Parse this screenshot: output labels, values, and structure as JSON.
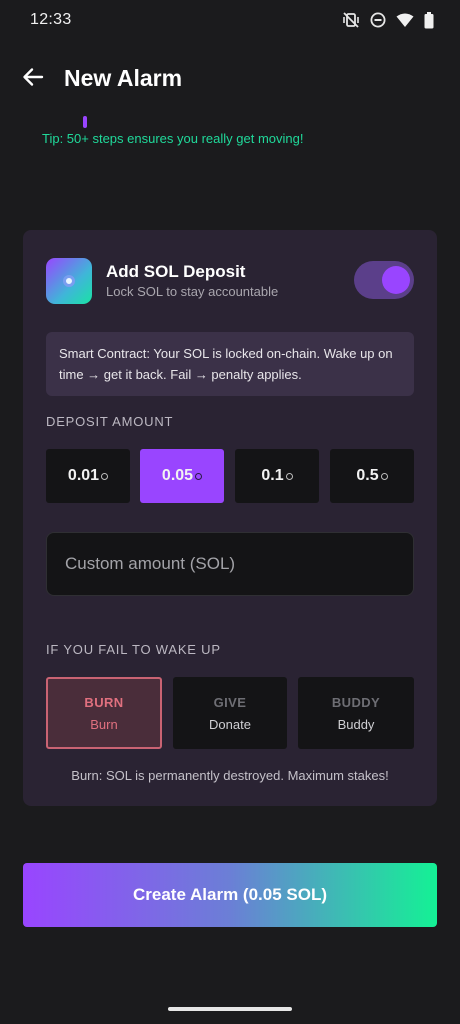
{
  "status_bar": {
    "time": "12:33",
    "icons": [
      "vibrate-off-icon",
      "do-not-disturb-icon",
      "wifi-icon",
      "battery-icon"
    ]
  },
  "header": {
    "back_icon": "arrow-left-icon",
    "title": "New Alarm"
  },
  "tip": {
    "text": "Tip: 50+ steps ensures you really get moving!"
  },
  "deposit_card": {
    "title": "Add SOL Deposit",
    "subtitle": "Lock SOL to stay accountable",
    "toggle_on": true,
    "info_text": "Smart Contract: Your SOL is locked on-chain. Wake up on time → get it back. Fail → penalty applies.",
    "amount_label": "DEPOSIT AMOUNT",
    "amounts": [
      {
        "label": "0.01",
        "selected": false
      },
      {
        "label": "0.05",
        "selected": true
      },
      {
        "label": "0.1",
        "selected": false
      },
      {
        "label": "0.5",
        "selected": false
      }
    ],
    "custom_placeholder": "Custom amount (SOL)",
    "fail_label": "IF YOU FAIL TO WAKE UP",
    "fail_options": [
      {
        "title": "BURN",
        "subtitle": "Burn",
        "selected": true
      },
      {
        "title": "GIVE",
        "subtitle": "Donate",
        "selected": false
      },
      {
        "title": "BUDDY",
        "subtitle": "Buddy",
        "selected": false
      }
    ],
    "fail_note": "Burn: SOL is permanently destroyed. Maximum stakes!"
  },
  "create_button": {
    "label": "Create Alarm (0.05 SOL)"
  },
  "colors": {
    "accent_purple": "#9945ff",
    "accent_green": "#14f195",
    "tip_green": "#20d99a",
    "burn_red": "#e0707f",
    "card_bg": "#2a2333",
    "page_bg": "#1b1b1d"
  }
}
